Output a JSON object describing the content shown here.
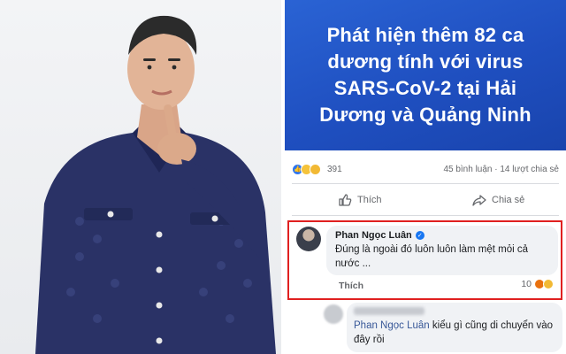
{
  "news": {
    "headline": "Phát hiện thêm 82 ca\ndương tính với virus\nSARS-CoV-2 tại Hải\nDương và Quảng Ninh"
  },
  "post_stats": {
    "reaction_count": "391",
    "comments_shares": "45 bình luận · 14 lượt chia sẻ"
  },
  "actions": {
    "like_label": "Thích",
    "share_label": "Chia sẻ"
  },
  "comment": {
    "author": "Phan Ngọc Luân",
    "text": "Đúng là ngoài đó luôn luôn làm mệt mỏi cả nước ...",
    "like_label": "Thích",
    "reaction_count": "10"
  },
  "reply": {
    "tag": "Phan Ngọc Luân",
    "text": " kiểu gì cũng di chuyển vào đây rồi"
  },
  "colors": {
    "banner": "#2a63d4",
    "highlight_border": "#e02020",
    "facebook_blue": "#1877f2",
    "shirt": "#2a3266"
  }
}
